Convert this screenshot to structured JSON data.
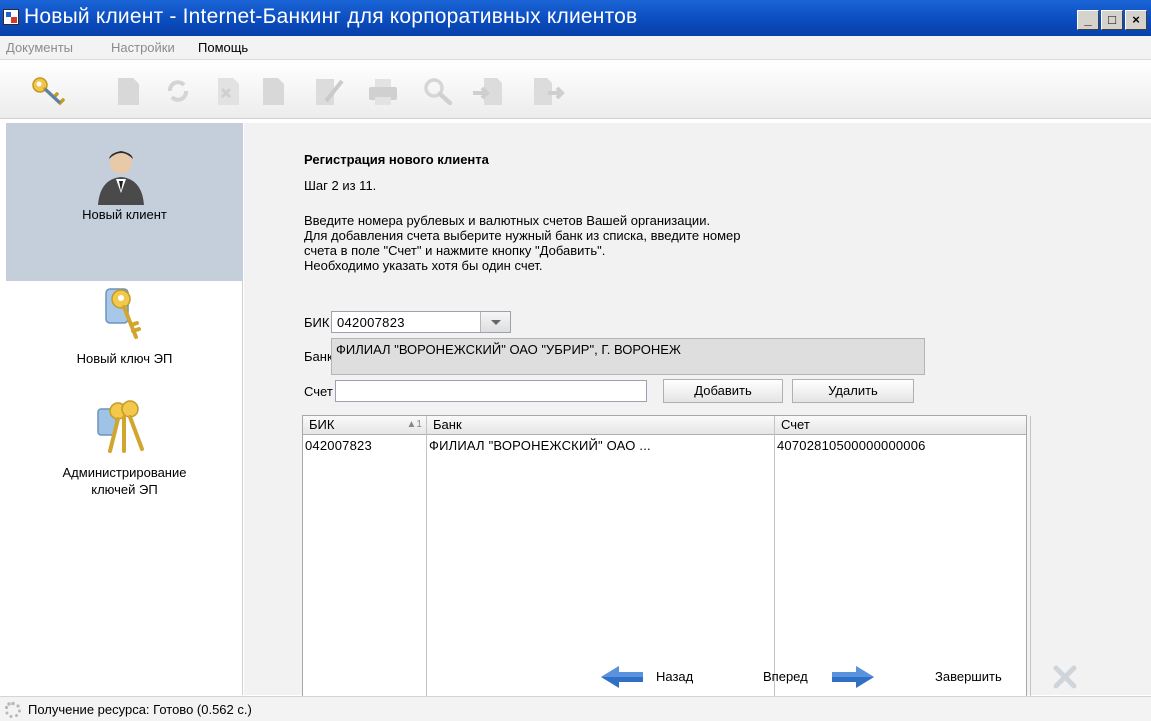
{
  "window": {
    "title": "Новый клиент - Internet-Банкинг для корпоративных клиентов",
    "minimize": "_",
    "maximize": "□",
    "close": "×"
  },
  "menu": {
    "items": [
      "Документы",
      "Настройки",
      "Помощь"
    ]
  },
  "toolbar": {
    "icons": [
      "key-icon",
      "new-document-icon",
      "refresh-icon",
      "delete-icon",
      "edit-icon",
      "print-icon",
      "search-icon",
      "import-icon",
      "export-icon"
    ]
  },
  "sidebar": {
    "items": [
      {
        "label": "Новый клиент",
        "icon": "user-icon",
        "selected": true
      },
      {
        "label": "Новый ключ ЭП",
        "icon": "key-tag-icon",
        "selected": false
      },
      {
        "label": "Администрирование\nключей ЭП",
        "label_line1": "Администрирование",
        "label_line2": "ключей ЭП",
        "icon": "keys-bunch-icon",
        "selected": false
      }
    ]
  },
  "main": {
    "heading": "Регистрация нового клиента",
    "step": "Шаг 2 из 11.",
    "instructions": [
      "Введите номера рублевых и валютных счетов Вашей организации.",
      "Для добавления счета выберите нужный банк из списка, введите номер",
      "счета в поле \"Счет\" и нажмите кнопку \"Добавить\".",
      "Необходимо указать хотя бы один счет."
    ],
    "bik_label": "БИК",
    "bik_value": "042007823",
    "bank_label": "Банк",
    "bank_value": "ФИЛИАЛ \"ВОРОНЕЖСКИЙ\" ОАО \"УБРИР\", Г. ВОРОНЕЖ",
    "account_label": "Счет",
    "account_value": "",
    "add_button": "Добавить",
    "delete_button": "Удалить"
  },
  "table": {
    "columns": [
      "БИК",
      "Банк",
      "Счет"
    ],
    "sort_indicator": "▲1",
    "rows": [
      {
        "bik": "042007823",
        "bank": "ФИЛИАЛ \"ВОРОНЕЖСКИЙ\" ОАО ...",
        "account": "40702810500000000006"
      }
    ]
  },
  "nav": {
    "back": "Назад",
    "forward": "Вперед",
    "finish": "Завершить"
  },
  "status": {
    "text": "Получение ресурса: Готово (0.562 с.)"
  },
  "colors": {
    "titlebar": "#0a4bbd",
    "selected_sidebar": "#c5cfdc",
    "arrow_blue": "#2f6fc4"
  }
}
